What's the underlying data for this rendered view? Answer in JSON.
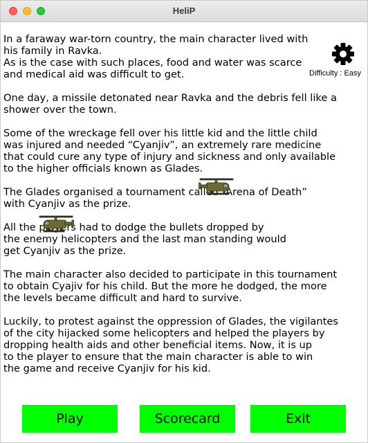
{
  "window": {
    "title": "HeliP"
  },
  "settings": {
    "icon": "gear-icon",
    "difficulty_text": "Difficulty : Easy"
  },
  "story": {
    "p1": "In a faraway war-torn country, the main character lived with\nhis family in Ravka.\nAs is the case with such places, food and water was scarce\nand medical aid was difficult to get.",
    "p2": "One day, a missile detonated near Ravka and the debris fell like a\nshower over the town.",
    "p3": "Some of the wreckage fell over his little kid and the little child\nwas injured and needed “Cyanjiv”, an extremely rare medicine\nthat could cure any type of injury and sickness and only available\nto the higher officials known as Glades.",
    "p4": "The Glades organised a tournament called “Arena of Death”\nwith Cyanjiv as the prize.",
    "p5": "All the players had to dodge the bullets dropped by\nthe enemy helicopters and the last man standing would\nget Cyanjiv as the prize.",
    "p6": "The main character also decided to participate in this tournament\nto obtain Cyajiv for his child. But the more he dodged, the more\nthe levels became difficult and hard to survive.",
    "p7": "Luckily, to protest against the oppression of Glades, the vigilantes\nof the city hijacked some helicopters and helped the players by\ndropping health aids and other beneficial items. Now, it is up\nto the player to ensure that the main character is able to win\nthe game and receive Cyanjiv for his kid."
  },
  "decor": {
    "helicopter_icon": "helicopter-icon",
    "helicopter_color": "#6b6a35"
  },
  "buttons": {
    "play": "Play",
    "scorecard": "Scorecard",
    "exit": "Exit",
    "color": "#00ff00"
  }
}
